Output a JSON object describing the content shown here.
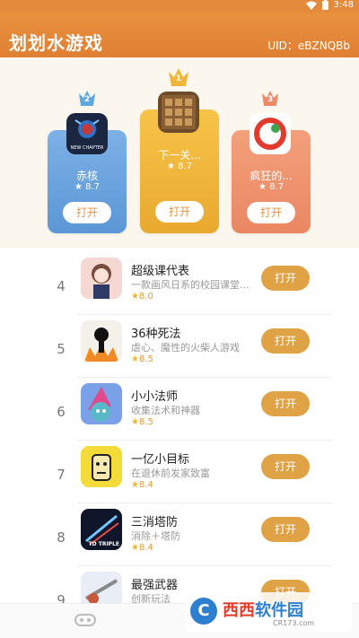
{
  "status_bar": {
    "time": "3:48"
  },
  "header": {
    "title": "划划水游戏",
    "uid": "UID：eBZNQBb"
  },
  "podium": [
    {
      "rank": "2",
      "name": "赤核",
      "rating": "8.7",
      "button": "打开",
      "icon_label": "NEW CHAPTER"
    },
    {
      "rank": "1",
      "name": "下一关...",
      "rating": "8.7",
      "button": "打开"
    },
    {
      "rank": "3",
      "name": "疯狂的...",
      "rating": "8.7",
      "button": "打开"
    }
  ],
  "list": [
    {
      "rank": "4",
      "name": "超级课代表",
      "desc": "一款画风日系的校园课堂...",
      "rating": "8.0",
      "button": "打开"
    },
    {
      "rank": "5",
      "name": "36种死法",
      "desc": "虐心、魔性的火柴人游戏",
      "rating": "8.5",
      "button": "打开"
    },
    {
      "rank": "6",
      "name": "小小法师",
      "desc": "收集法术和神器",
      "rating": "8.5",
      "button": "打开"
    },
    {
      "rank": "7",
      "name": "一亿小目标",
      "desc": "在退休前发家致富",
      "rating": "8.4",
      "button": "打开"
    },
    {
      "rank": "8",
      "name": "三消塔防",
      "desc": "消除＋塔防",
      "rating": "8.4",
      "button": "打开",
      "icon_label": "TD TRIPLE"
    },
    {
      "rank": "9",
      "name": "最强武器",
      "desc": "创新玩法",
      "rating": "",
      "button": "打开"
    }
  ],
  "watermark": {
    "brand_a": "西西",
    "brand_b": "软件园",
    "url": "CR173.com"
  },
  "colors": {
    "header": "#e48a3c",
    "open_button": "#dfa245",
    "star": "#f2b530"
  }
}
